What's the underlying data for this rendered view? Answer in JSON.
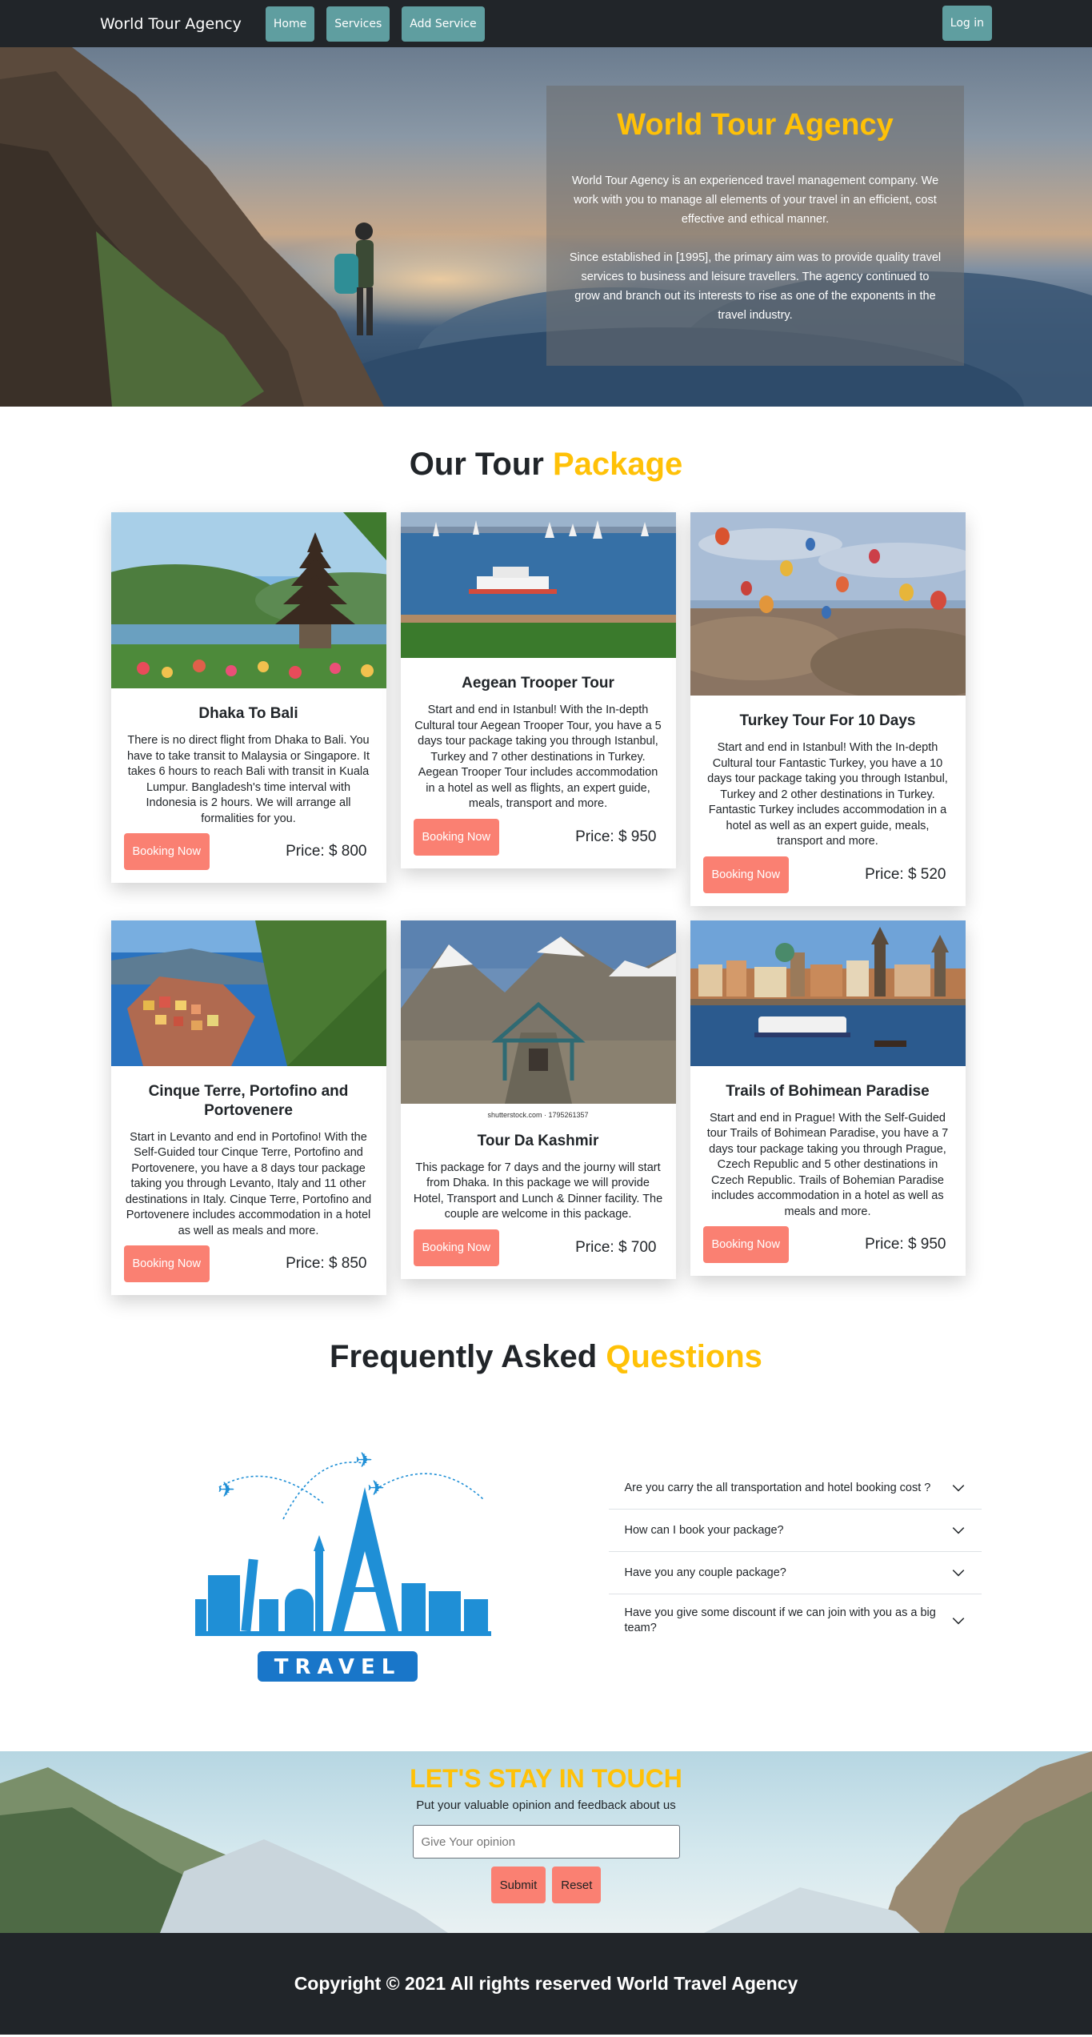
{
  "nav": {
    "brand": "World Tour Agency",
    "items": [
      "Home",
      "Services",
      "Add Service"
    ],
    "login": "Log in"
  },
  "hero": {
    "title": "World Tour Agency",
    "p1": "World Tour Agency is an experienced travel management company. We work with you to manage all elements of your travel in an efficient, cost effective and ethical manner.",
    "p2": "Since established in [1995], the primary aim was to provide quality travel services to business and leisure travellers. The agency continued to grow and branch out its interests to rise as one of the exponents in the travel industry."
  },
  "packages": {
    "title_main": "Our Tour",
    "title_accent": "Package",
    "cards": [
      {
        "title": "Dhaka To Bali",
        "text": "There is no direct flight from Dhaka to Bali. You have to take transit to Malaysia or Singapore. It takes 6 hours to reach Bali with transit in Kuala Lumpur. Bangladesh's time interval with Indonesia is 2 hours. We will arrange all formalities for you.",
        "button": "Booking Now",
        "price": "Price: $ 800"
      },
      {
        "title": "Aegean Trooper Tour",
        "text": "Start and end in Istanbul! With the In-depth Cultural tour Aegean Trooper Tour, you have a 5 days tour package taking you through Istanbul, Turkey and 7 other destinations in Turkey. Aegean Trooper Tour includes accommodation in a hotel as well as flights, an expert guide, meals, transport and more.",
        "button": "Booking Now",
        "price": "Price: $ 950"
      },
      {
        "title": "Turkey Tour For 10 Days",
        "text": "Start and end in Istanbul! With the In-depth Cultural tour Fantastic Turkey, you have a 10 days tour package taking you through Istanbul, Turkey and 2 other destinations in Turkey. Fantastic Turkey includes accommodation in a hotel as well as an expert guide, meals, transport and more.",
        "button": "Booking Now",
        "price": "Price: $ 520"
      },
      {
        "title": "Cinque Terre, Portofino and Portovenere",
        "text": "Start in Levanto and end in Portofino! With the Self-Guided tour Cinque Terre, Portofino and Portovenere, you have a 8 days tour package taking you through Levanto, Italy and 11 other destinations in Italy. Cinque Terre, Portofino and Portovenere includes accommodation in a hotel as well as meals and more.",
        "button": "Booking Now",
        "price": "Price: $ 850"
      },
      {
        "title": "Tour Da Kashmir",
        "text": "This package for 7 days and the journy will start from Dhaka. In this package we will provide Hotel, Transport and Lunch & Dinner facility. The couple are welcome in this package.",
        "button": "Booking Now",
        "price": "Price: $ 700",
        "watermark": "shutterstock.com · 1795261357"
      },
      {
        "title": "Trails of Bohimean Paradise",
        "text": "Start and end in Prague! With the Self-Guided tour Trails of Bohimean Paradise, you have a 7 days tour package taking you through Prague, Czech Republic and 5 other destinations in Czech Republic. Trails of Bohemian Paradise includes accommodation in a hotel as well as meals and more.",
        "button": "Booking Now",
        "price": "Price: $ 950"
      }
    ]
  },
  "faq": {
    "title_main": "Frequently Asked",
    "title_accent": "Questions",
    "art_word": "TRAVEL",
    "questions": [
      "Are you carry the all transportation and hotel booking cost ?",
      "How can I book your package?",
      "Have you any couple package?",
      "Have you give some discount if we can join with you as a big team?"
    ]
  },
  "touch": {
    "title": "LET'S STAY IN TOUCH",
    "subtitle": "Put your valuable opinion and feedback about us",
    "placeholder": "Give Your opinion",
    "submit": "Submit",
    "reset": "Reset"
  },
  "footer": {
    "text": "Copyright © 2021 All rights reserved World Travel Agency"
  }
}
